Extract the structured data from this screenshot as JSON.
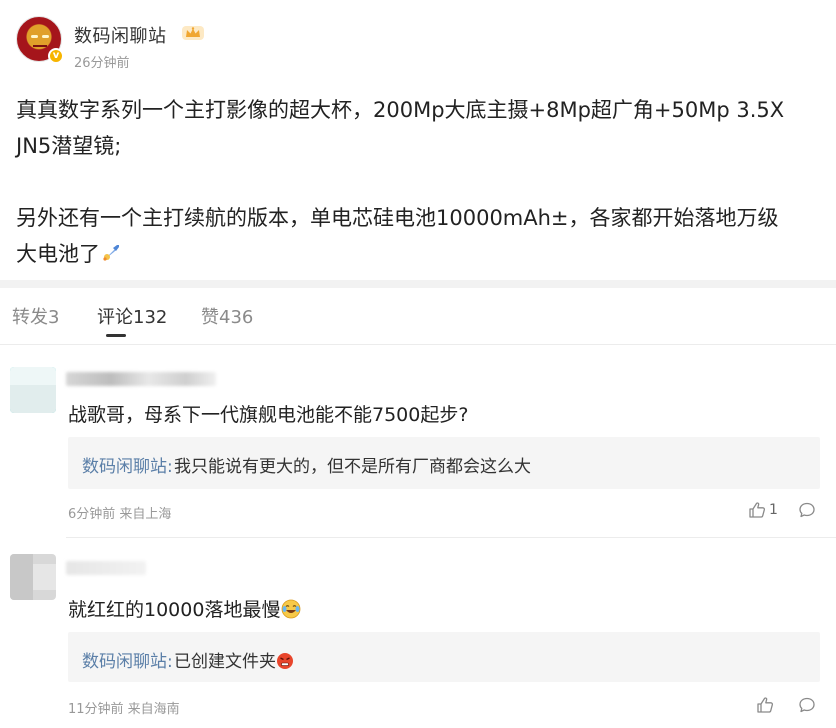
{
  "post": {
    "author": "数码闲聊站",
    "time": "26分钟前",
    "line1": "真真数字系列一个主打影像的超大杯，200Mp大底主摄+8Mp超广角+50Mp 3.5X",
    "line2": "JN5潜望镜;",
    "line3": "另外还有一个主打续航的版本，单电芯硅电池10000mAh±，各家都开始落地万级",
    "line4": "大电池了",
    "icons": {
      "avatar": "iron-man-avatar",
      "badge": "verified-badge",
      "crown": "crown-icon",
      "emoji": "rocket-emoji"
    }
  },
  "tabs": {
    "repost": "转发3",
    "comments": "评论132",
    "likes": "赞436",
    "active": "comments"
  },
  "comments": [
    {
      "text": "战歌哥，母系下一代旗舰电池能不能7500起步?",
      "reply_author": "数码闲聊站:",
      "reply_text": "我只能说有更大的，但不是所有厂商都会这么大",
      "meta": "6分钟前 来自上海",
      "like_count": "1"
    },
    {
      "text": "就红红的10000落地最慢",
      "reply_author": "数码闲聊站:",
      "reply_text": "已创建文件夹",
      "meta": "11分钟前 来自海南",
      "like_count": ""
    }
  ],
  "colors": {
    "link": "#5b7fa8",
    "muted": "#999999",
    "reply_bg": "#f5f5f5",
    "badge": "#f7b500"
  }
}
